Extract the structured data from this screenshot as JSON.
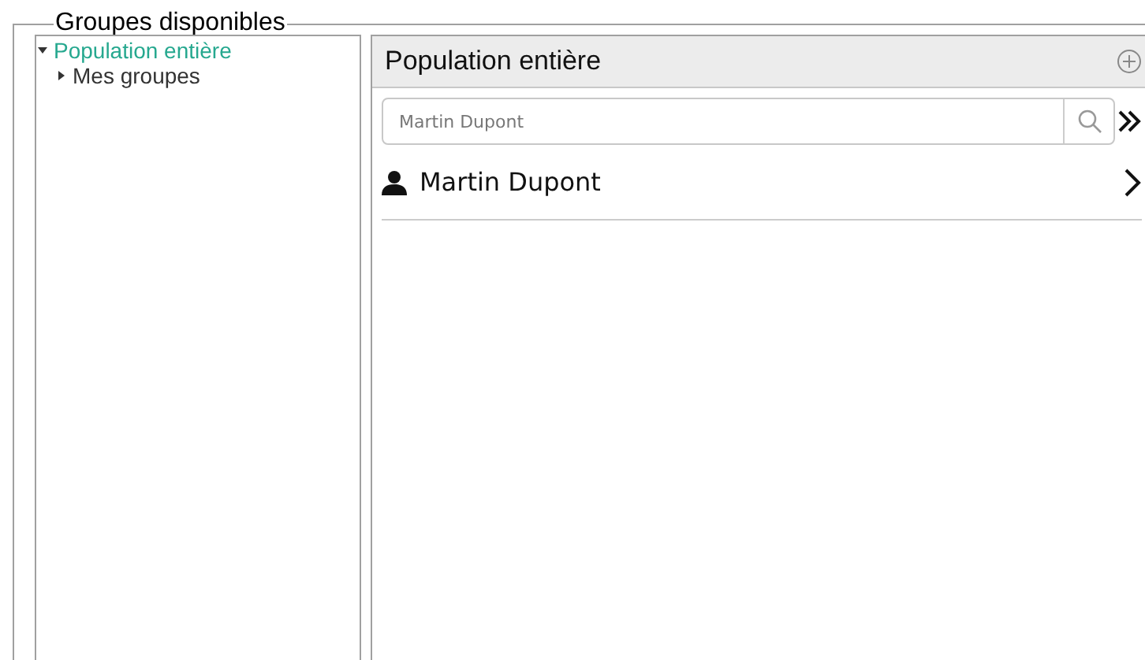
{
  "group_box": {
    "title": "Groupes disponibles"
  },
  "tree": [
    {
      "label": "Population entière",
      "selected": true,
      "expanded": true,
      "children": [
        {
          "label": "Mes groupes",
          "selected": false,
          "expanded": false
        }
      ]
    }
  ],
  "panel": {
    "title": "Population entière",
    "search": {
      "placeholder": "Martin Dupont"
    },
    "people": [
      {
        "name": "Martin Dupont"
      }
    ]
  }
}
